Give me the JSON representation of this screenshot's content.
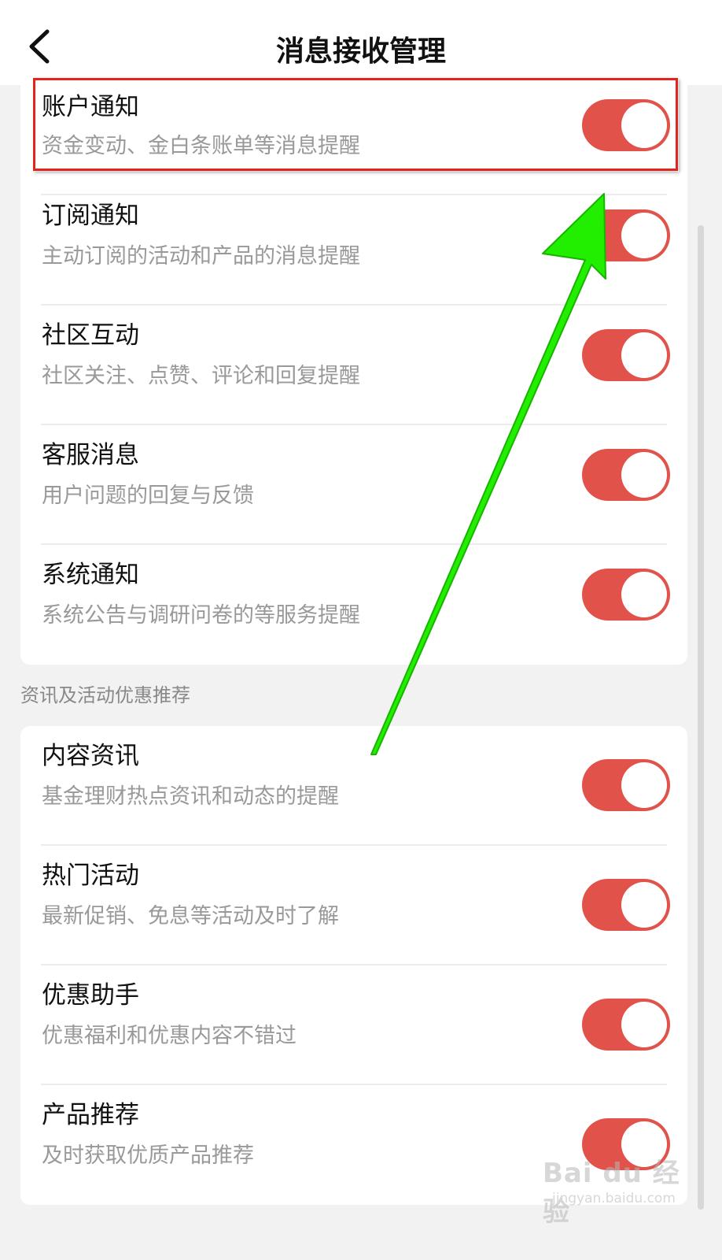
{
  "header": {
    "title": "消息接收管理",
    "back_icon": "chevron-left-icon"
  },
  "section_1": {
    "items": [
      {
        "title": "账户通知",
        "desc": "资金变动、金白条账单等消息提醒",
        "enabled": true
      },
      {
        "title": "订阅通知",
        "desc": "主动订阅的活动和产品的消息提醒",
        "enabled": true
      },
      {
        "title": "社区互动",
        "desc": "社区关注、点赞、评论和回复提醒",
        "enabled": true
      },
      {
        "title": "客服消息",
        "desc": "用户问题的回复与反馈",
        "enabled": true
      },
      {
        "title": "系统通知",
        "desc": "系统公告与调研问卷的等服务提醒",
        "enabled": true
      }
    ]
  },
  "section_2": {
    "label": "资讯及活动优惠推荐",
    "items": [
      {
        "title": "内容资讯",
        "desc": "基金理财热点资讯和动态的提醒",
        "enabled": true
      },
      {
        "title": "热门活动",
        "desc": "最新促销、免息等活动及时了解",
        "enabled": true
      },
      {
        "title": "优惠助手",
        "desc": "优惠福利和优惠内容不错过",
        "enabled": true
      },
      {
        "title": "产品推荐",
        "desc": "及时获取优质产品推荐",
        "enabled": true
      }
    ]
  },
  "watermark": {
    "brand": "Bai du 经验",
    "url": "jingyan.baidu.com"
  },
  "colors": {
    "toggle_on": "#e0524a",
    "highlight_border": "#e2241c",
    "annotation_arrow": "#22ee00"
  }
}
